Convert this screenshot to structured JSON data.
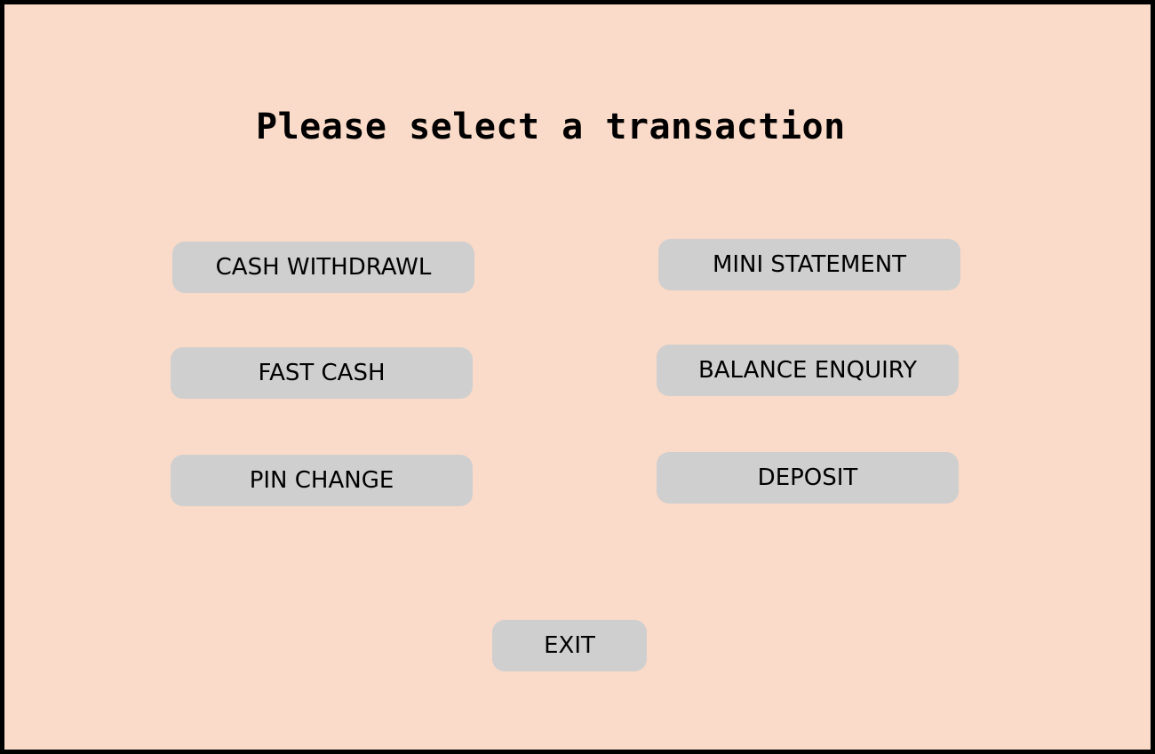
{
  "screen": {
    "title": "Please select a transaction",
    "colors": {
      "background": "#FADAC8",
      "border": "#000000",
      "button": "#CFCFCF",
      "text": "#000000"
    }
  },
  "buttons": {
    "cash_withdrawal": "CASH WITHDRAWL",
    "fast_cash": "FAST CASH",
    "pin_change": "PIN CHANGE",
    "mini_statement": "MINI STATEMENT",
    "balance_enquiry": "BALANCE ENQUIRY",
    "deposit": "DEPOSIT",
    "exit": "EXIT"
  }
}
